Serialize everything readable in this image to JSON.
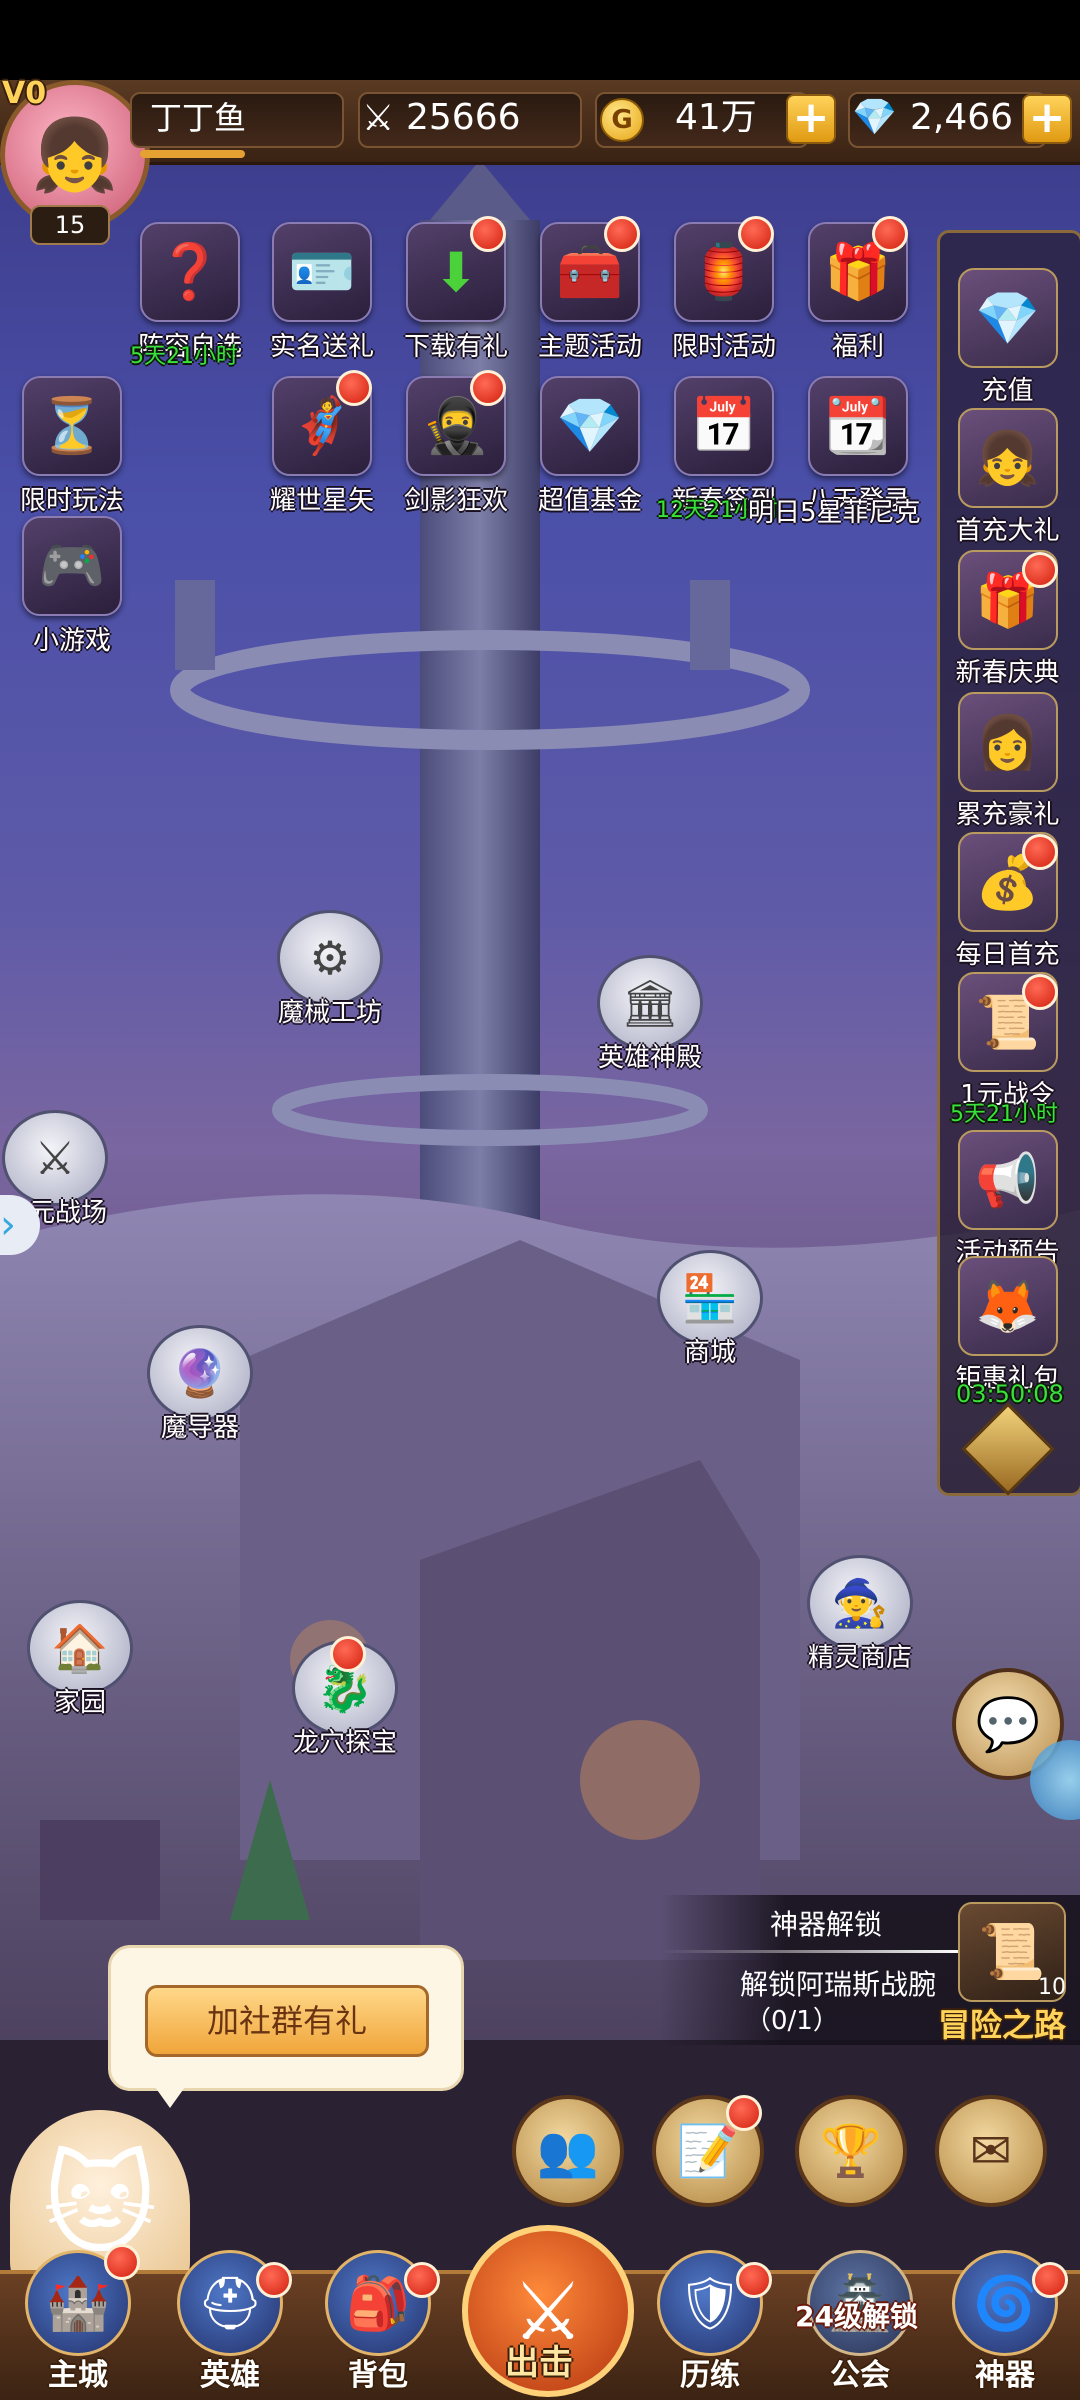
{
  "player": {
    "vip": "V0",
    "name": "丁丁鱼",
    "level": "15",
    "power": "25666",
    "gold": "41万",
    "diamonds": "2,466",
    "gold_icon": "G"
  },
  "top_icons": [
    {
      "label": "阵容自选",
      "icon": "❓",
      "timer": "5天21小时"
    },
    {
      "label": "实名送礼",
      "icon": "🪪"
    },
    {
      "label": "下载有礼",
      "icon": "⬇"
    },
    {
      "label": "主题活动",
      "icon": "🧰"
    },
    {
      "label": "限时活动",
      "icon": "🏮"
    },
    {
      "label": "福利",
      "icon": "🎁"
    },
    {
      "label": "限时玩法",
      "icon": "⏳"
    },
    {
      "label": "耀世星矢",
      "icon": "🦸"
    },
    {
      "label": "剑影狂欢",
      "icon": "🥷"
    },
    {
      "label": "超值基金",
      "icon": "💎"
    },
    {
      "label": "新春签到",
      "icon": "📅",
      "timer": "12天21小时"
    },
    {
      "label": "八天登录",
      "icon": "📆",
      "sub": "明日5星菲尼克"
    },
    {
      "label": "小游戏",
      "icon": "🎮"
    }
  ],
  "right_panel": [
    {
      "label": "充值",
      "icon": "💎"
    },
    {
      "label": "首充大礼",
      "icon": "👧"
    },
    {
      "label": "新春庆典",
      "icon": "🎁"
    },
    {
      "label": "累充豪礼",
      "icon": "👩"
    },
    {
      "label": "每日首充",
      "icon": "💰"
    },
    {
      "label": "1元战令",
      "icon": "📜",
      "timer": "5天21小时"
    },
    {
      "label": "活动预告",
      "icon": "📢"
    },
    {
      "label": "钜惠礼包",
      "icon": "🦊",
      "timer": "03:50:08"
    }
  ],
  "buildings": [
    {
      "label": "魔械工坊",
      "icon": "⚙"
    },
    {
      "label": "英雄神殿",
      "icon": "🏛"
    },
    {
      "label": "次元战场",
      "icon": "⚔"
    },
    {
      "label": "商城",
      "icon": "🏪"
    },
    {
      "label": "魔导器",
      "icon": "🔮"
    },
    {
      "label": "精灵商店",
      "icon": "🧙"
    },
    {
      "label": "家园",
      "icon": "🏠"
    },
    {
      "label": "龙穴探宝",
      "icon": "🐉"
    }
  ],
  "quest": {
    "title": "神器解锁",
    "desc": "解锁阿瑞斯战腕",
    "progress": "（0/1）",
    "road_label": "冒险之路",
    "road_count": "10"
  },
  "community": {
    "label": "加社群有礼"
  },
  "nav": [
    {
      "label": "主城",
      "icon": "🏰"
    },
    {
      "label": "英雄",
      "icon": "⛑"
    },
    {
      "label": "背包",
      "icon": "🎒"
    },
    {
      "label": "出击",
      "icon": "⚔"
    },
    {
      "label": "历练",
      "icon": "🛡"
    },
    {
      "label": "公会",
      "icon": "🏯",
      "lock": "24级解锁"
    },
    {
      "label": "神器",
      "icon": "🌀"
    }
  ]
}
